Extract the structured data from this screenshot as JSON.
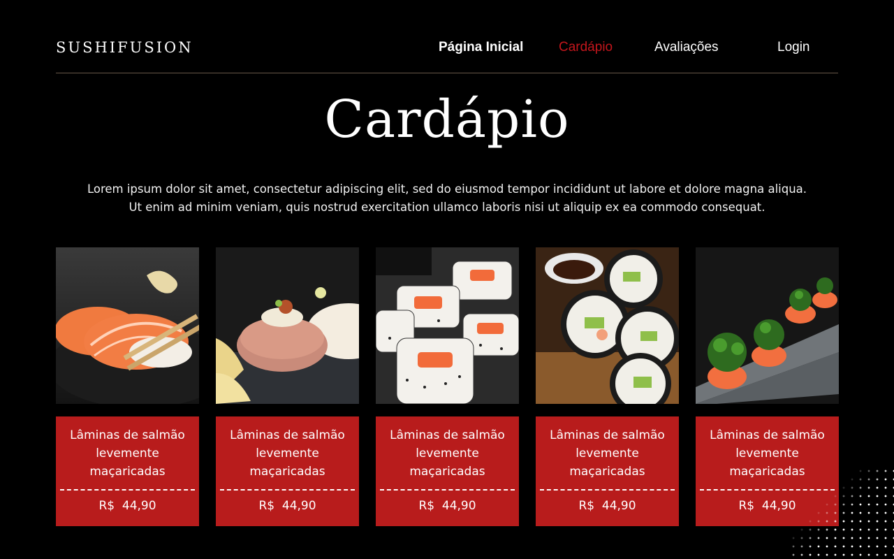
{
  "brand": {
    "name": "SUSHIFUSION"
  },
  "nav": {
    "items": [
      {
        "label": "Página Inicial"
      },
      {
        "label": "Cardápio",
        "active": true
      },
      {
        "label": "Avaliações"
      },
      {
        "label": "Login"
      }
    ]
  },
  "page": {
    "title": "Cardápio",
    "intro": "Lorem ipsum dolor sit amet, consectetur adipiscing elit, sed do eiusmod tempor incididunt ut labore et dolore magna aliqua. Ut enim ad minim veniam, quis nostrud exercitation ullamco laboris nisi ut aliquip ex ea commodo consequat."
  },
  "colors": {
    "accent": "#c4161c",
    "card_bg": "#b81c1c",
    "background": "#000000"
  },
  "menu": {
    "items": [
      {
        "name": "Lâminas de salmão levemente maçaricadas",
        "currency": "R$",
        "price": "44,90",
        "image": "salmon-nigiri-chopsticks"
      },
      {
        "name": "Lâminas de salmão levemente maçaricadas",
        "currency": "R$",
        "price": "44,90",
        "image": "tuna-wrapped-nigiri"
      },
      {
        "name": "Lâminas de salmão levemente maçaricadas",
        "currency": "R$",
        "price": "44,90",
        "image": "uramaki-rolls"
      },
      {
        "name": "Lâminas de salmão levemente maçaricadas",
        "currency": "R$",
        "price": "44,90",
        "image": "futomaki-rolls"
      },
      {
        "name": "Lâminas de salmão levemente maçaricadas",
        "currency": "R$",
        "price": "44,90",
        "image": "salmon-rolls-seaweed"
      }
    ]
  }
}
